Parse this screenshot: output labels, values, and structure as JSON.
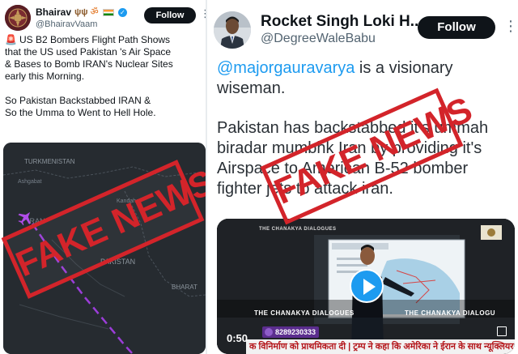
{
  "left_tweet": {
    "author_name": "Bhairav",
    "emoji_trishul": "ψ",
    "emoji_om": "ॐ",
    "handle": "@BhairavVaam",
    "follow_label": "Follow",
    "more_label": "⋮",
    "siren": "🚨",
    "text_lines": [
      "US B2 Bombers Flight Path Shows",
      "that the US used Pakistan 's Air Space",
      "& Bases to Bomb IRAN's Nuclear Sites",
      "early this Morning."
    ],
    "text_lines_2": [
      "So Pakistan Backstabbed IRAN &",
      "So the Umma to Went to Hell Hole."
    ],
    "map": {
      "labels": [
        "TURKMENISTAN",
        "Ashgabat",
        "IRAN",
        "PAKISTAN",
        "BHARAT",
        "Kandahar"
      ],
      "route_color": "#9b3dd8"
    }
  },
  "right_tweet": {
    "author_name": "Rocket Singh Loki H...",
    "handle": "@DegreeWaleBabu",
    "follow_label": "Follow",
    "more_label": "⋮",
    "mention": "@majorgauravarya",
    "line1_rest": " is a visionary",
    "line2": "wiseman.",
    "para2_lines": [
      "Pakistan has backstabbed it's ummah",
      "biradar mumbhk Iran by providing it's",
      "Airspace to American B-52 bomber",
      "fighter jets to attack iran."
    ],
    "video": {
      "timestamp": "0:50",
      "brand_top": "THE CHANAKYA DIALOGUES",
      "caption_bottom": "THE CHANAKYA DIALOGUES",
      "caption_bottom_right": "THE CHANAKYA DIALOGU",
      "phone": "8289230333",
      "ticker": "क विनिर्माण को प्राथमिकता दी | ट्रम्प ने कहा कि अमेरिका ने ईरान के साथ न्यूक्लियर"
    }
  },
  "stamps": {
    "left": "FAKE NEWS",
    "right": "FAKE NEWS",
    "color": "#d3242a"
  }
}
